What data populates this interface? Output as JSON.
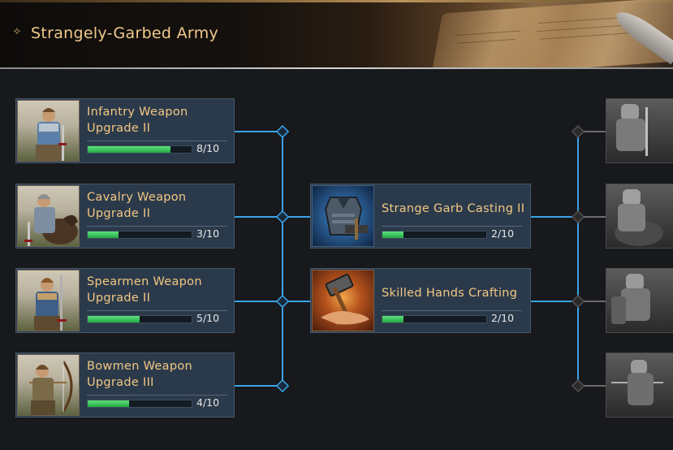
{
  "header": {
    "title": "Strangely-Garbed Army"
  },
  "left_items": [
    {
      "title_line1": "Infantry Weapon",
      "title_line2": "Upgrade II",
      "progress": "8/10",
      "fraction": 0.8
    },
    {
      "title_line1": "Cavalry Weapon",
      "title_line2": "Upgrade II",
      "progress": "3/10",
      "fraction": 0.3
    },
    {
      "title_line1": "Spearmen Weapon",
      "title_line2": "Upgrade II",
      "progress": "5/10",
      "fraction": 0.5
    },
    {
      "title_line1": "Bowmen Weapon",
      "title_line2": "Upgrade III",
      "progress": "4/10",
      "fraction": 0.4
    }
  ],
  "middle_items": [
    {
      "title": "Strange Garb Casting II",
      "progress": "2/10",
      "fraction": 0.2
    },
    {
      "title": "Skilled Hands Crafting",
      "progress": "2/10",
      "fraction": 0.2
    }
  ],
  "colors": {
    "connector": "#3aa3e8",
    "connector_locked": "#6b6b6b",
    "progress_fill": "#2fbf55",
    "title_text": "#f2c782"
  }
}
